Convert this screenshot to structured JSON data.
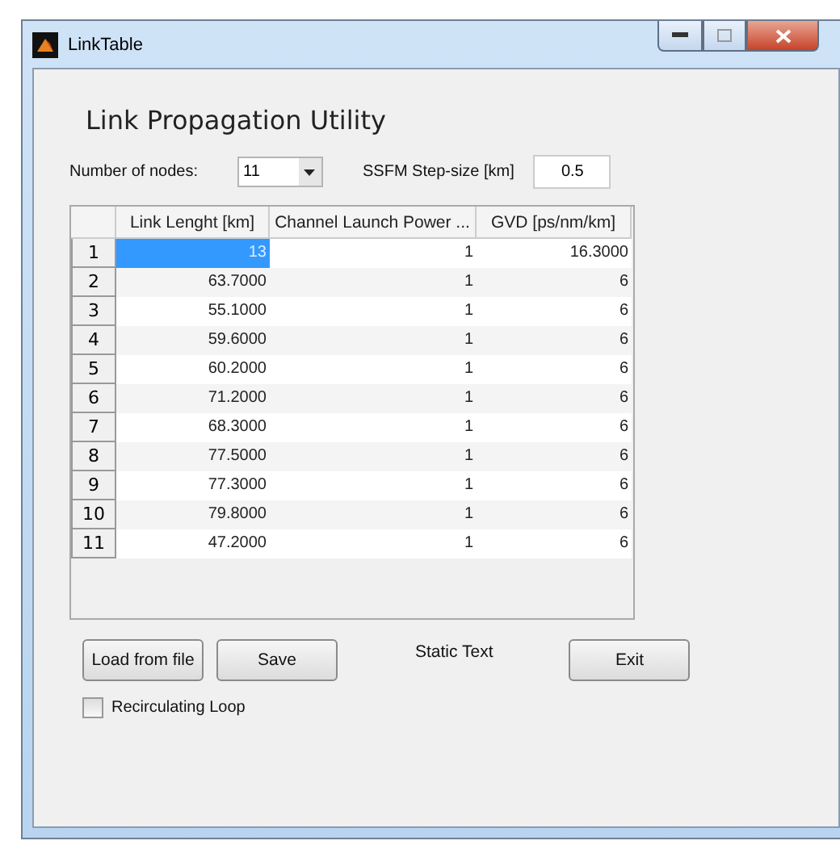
{
  "window": {
    "title": "LinkTable"
  },
  "heading": "Link Propagation Utility",
  "nodes": {
    "label": "Number of nodes:",
    "value": "11"
  },
  "step": {
    "label": "SSFM Step-size [km]",
    "value": "0.5"
  },
  "table": {
    "columns": [
      "Link Lenght [km]",
      "Channel Launch Power ...",
      "GVD [ps/nm/km]"
    ],
    "rows": [
      {
        "label": "1",
        "cells": [
          {
            "text": "13",
            "selected": true
          },
          {
            "text": "1",
            "selected": false
          },
          {
            "text": "16.3000",
            "selected": false
          }
        ]
      },
      {
        "label": "2",
        "cells": [
          {
            "text": "63.7000",
            "selected": false
          },
          {
            "text": "1",
            "selected": false
          },
          {
            "text": "6",
            "selected": false
          }
        ]
      },
      {
        "label": "3",
        "cells": [
          {
            "text": "55.1000",
            "selected": false
          },
          {
            "text": "1",
            "selected": false
          },
          {
            "text": "6",
            "selected": false
          }
        ]
      },
      {
        "label": "4",
        "cells": [
          {
            "text": "59.6000",
            "selected": false
          },
          {
            "text": "1",
            "selected": false
          },
          {
            "text": "6",
            "selected": false
          }
        ]
      },
      {
        "label": "5",
        "cells": [
          {
            "text": "60.2000",
            "selected": false
          },
          {
            "text": "1",
            "selected": false
          },
          {
            "text": "6",
            "selected": false
          }
        ]
      },
      {
        "label": "6",
        "cells": [
          {
            "text": "71.2000",
            "selected": false
          },
          {
            "text": "1",
            "selected": false
          },
          {
            "text": "6",
            "selected": false
          }
        ]
      },
      {
        "label": "7",
        "cells": [
          {
            "text": "68.3000",
            "selected": false
          },
          {
            "text": "1",
            "selected": false
          },
          {
            "text": "6",
            "selected": false
          }
        ]
      },
      {
        "label": "8",
        "cells": [
          {
            "text": "77.5000",
            "selected": false
          },
          {
            "text": "1",
            "selected": false
          },
          {
            "text": "6",
            "selected": false
          }
        ]
      },
      {
        "label": "9",
        "cells": [
          {
            "text": "77.3000",
            "selected": false
          },
          {
            "text": "1",
            "selected": false
          },
          {
            "text": "6",
            "selected": false
          }
        ]
      },
      {
        "label": "10",
        "cells": [
          {
            "text": "79.8000",
            "selected": false
          },
          {
            "text": "1",
            "selected": false
          },
          {
            "text": "6",
            "selected": false
          }
        ]
      },
      {
        "label": "11",
        "cells": [
          {
            "text": "47.2000",
            "selected": false
          },
          {
            "text": "1",
            "selected": false
          },
          {
            "text": "6",
            "selected": false
          }
        ]
      }
    ]
  },
  "buttons": {
    "load": "Load from file",
    "save": "Save",
    "exit": "Exit"
  },
  "static_text": "Static Text",
  "checkbox": {
    "label": "Recirculating Loop",
    "checked": false
  }
}
